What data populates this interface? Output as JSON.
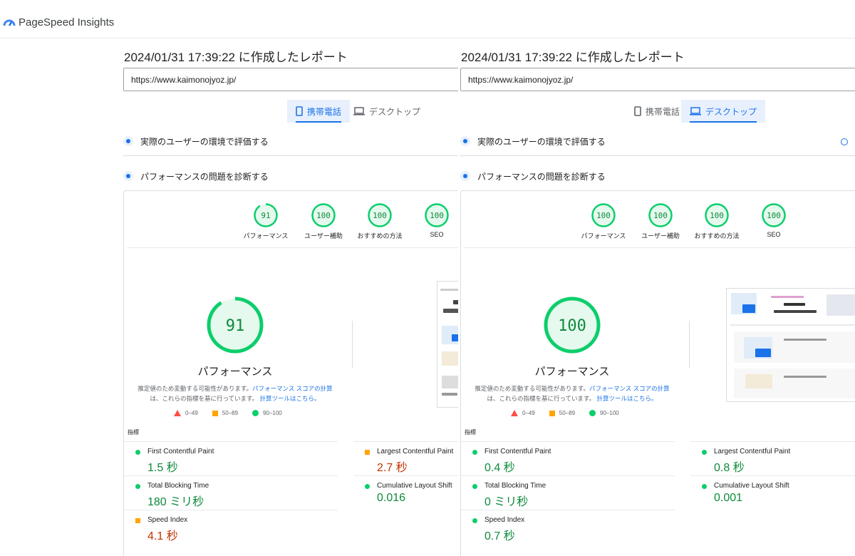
{
  "app": {
    "title": "PageSpeed Insights"
  },
  "panels": [
    {
      "report_title": "2024/01/31 17:39:22 に作成したレポート",
      "url": "https://www.kaimonojyoz.jp/",
      "tabs": [
        {
          "label": "携帯電話",
          "icon": "phone-icon",
          "active": true
        },
        {
          "label": "デスクトップ",
          "icon": "laptop-icon",
          "active": false
        }
      ],
      "section_field": "実際のユーザーの環境で評価する",
      "section_diagnose": "パフォーマンスの問題を診断する",
      "categories": [
        {
          "score": "91",
          "label": "パフォーマンス"
        },
        {
          "score": "100",
          "label": "ユーザー補助"
        },
        {
          "score": "100",
          "label": "おすすめの方法"
        },
        {
          "score": "100",
          "label": "SEO"
        }
      ],
      "main_score": "91",
      "main_label": "パフォーマンス",
      "desc_part1": "推定値のため変動する可能性があります。",
      "desc_link1": "パフォーマンス スコアの計算",
      "desc_part2": "は、これらの指標を基に行っています。",
      "desc_link2": "計算ツールはこちら。",
      "legend": {
        "fail": "0–49",
        "average": "50–89",
        "pass": "90–100"
      },
      "metrics_heading": "指標",
      "metrics": [
        {
          "name": "First Contentful Paint",
          "value": "1.5 秒",
          "rating": "pass"
        },
        {
          "name": "Largest Contentful Paint",
          "value": "2.7 秒",
          "rating": "average"
        },
        {
          "name": "Total Blocking Time",
          "value": "180 ミリ秒",
          "rating": "pass"
        },
        {
          "name": "Cumulative Layout Shift",
          "value": "0.016",
          "rating": "pass"
        },
        {
          "name": "Speed Index",
          "value": "4.1 秒",
          "rating": "average"
        }
      ]
    },
    {
      "report_title": "2024/01/31 17:39:22 に作成したレポート",
      "url": "https://www.kaimonojyoz.jp/",
      "tabs": [
        {
          "label": "携帯電話",
          "icon": "phone-icon",
          "active": false
        },
        {
          "label": "デスクトップ",
          "icon": "laptop-icon",
          "active": true
        }
      ],
      "section_field": "実際のユーザーの環境で評価する",
      "section_diagnose": "パフォーマンスの問題を診断する",
      "categories": [
        {
          "score": "100",
          "label": "パフォーマンス"
        },
        {
          "score": "100",
          "label": "ユーザー補助"
        },
        {
          "score": "100",
          "label": "おすすめの方法"
        },
        {
          "score": "100",
          "label": "SEO"
        }
      ],
      "main_score": "100",
      "main_label": "パフォーマンス",
      "desc_part1": "推定値のため変動する可能性があります。",
      "desc_link1": "パフォーマンス スコアの計算",
      "desc_part2": "は、これらの指標を基に行っています。",
      "desc_link2": "計算ツールはこちら。",
      "legend": {
        "fail": "0–49",
        "average": "50–89",
        "pass": "90–100"
      },
      "metrics_heading": "指標",
      "metrics": [
        {
          "name": "First Contentful Paint",
          "value": "0.4 秒",
          "rating": "pass"
        },
        {
          "name": "Largest Contentful Paint",
          "value": "0.8 秒",
          "rating": "pass"
        },
        {
          "name": "Total Blocking Time",
          "value": "0 ミリ秒",
          "rating": "pass"
        },
        {
          "name": "Cumulative Layout Shift",
          "value": "0.001",
          "rating": "pass"
        },
        {
          "name": "Speed Index",
          "value": "0.7 秒",
          "rating": "pass"
        }
      ]
    }
  ],
  "colors": {
    "pass": "#0cce6b",
    "pass_text": "#0d8a3b",
    "average": "#ffa400",
    "average_text": "#c33300",
    "fail": "#ff4e42",
    "accent": "#1a73e8",
    "gauge_fill": "#e6f9ee"
  }
}
